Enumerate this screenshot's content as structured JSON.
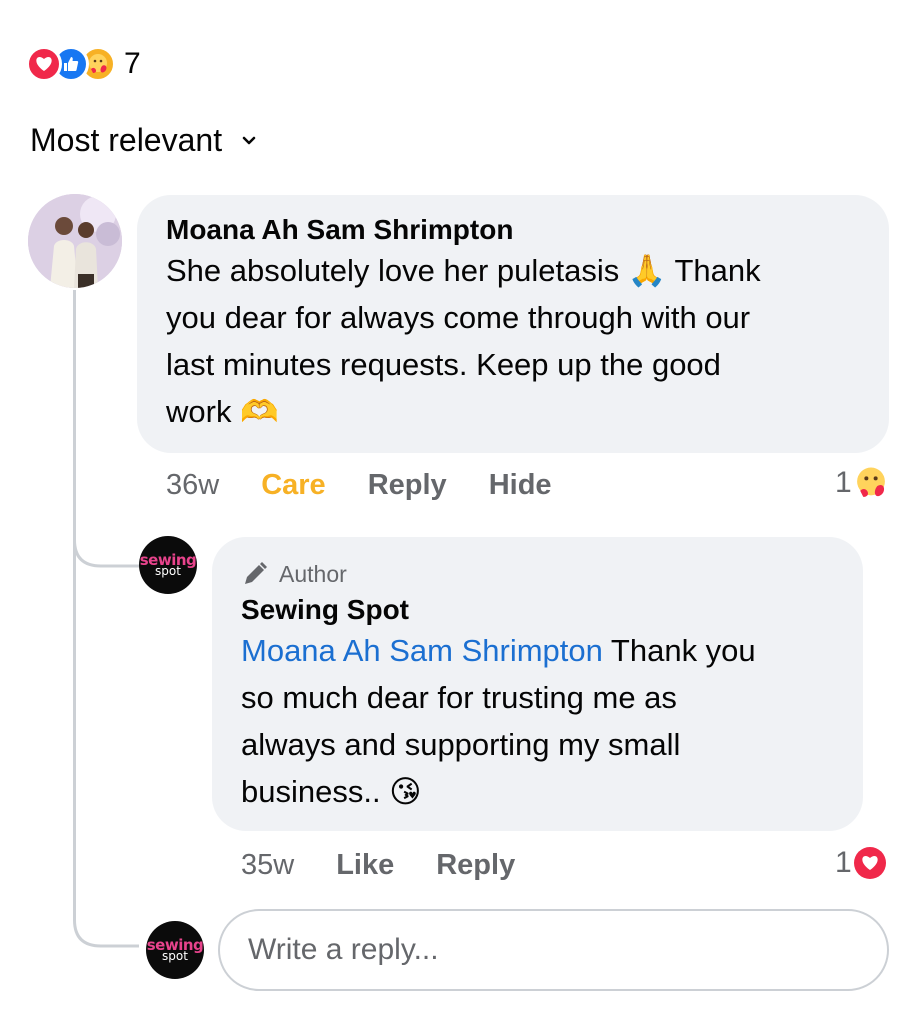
{
  "reactions": {
    "count": "7",
    "types": [
      "love-icon",
      "like-icon",
      "care-icon"
    ]
  },
  "sort": {
    "label": "Most relevant"
  },
  "comment": {
    "author": "Moana Ah Sam Shrimpton",
    "lines": [
      "She absolutely love her puletasis 🙏 Thank",
      "you dear for always come through with our",
      "last minutes requests. Keep up the good",
      "work 🫶"
    ],
    "time": "36w",
    "reaction_label": "Care",
    "reply_label": "Reply",
    "hide_label": "Hide",
    "reaction_count": "1",
    "colors": {
      "care": "#f7b125"
    }
  },
  "reply": {
    "badge": "Author",
    "author": "Sewing Spot",
    "mention": "Moana Ah Sam Shrimpton",
    "line1_rest": " Thank you",
    "lines": [
      "so much dear for trusting me as",
      "always and supporting my small",
      "business.. 😘"
    ],
    "time": "35w",
    "like_label": "Like",
    "reply_label": "Reply",
    "reaction_count": "1",
    "colors": {
      "mention": "#1b6fd1",
      "love": "#f0284a"
    }
  },
  "logo": {
    "top": "sewing",
    "bottom": "spot"
  },
  "reply_box": {
    "placeholder": "Write a reply..."
  }
}
